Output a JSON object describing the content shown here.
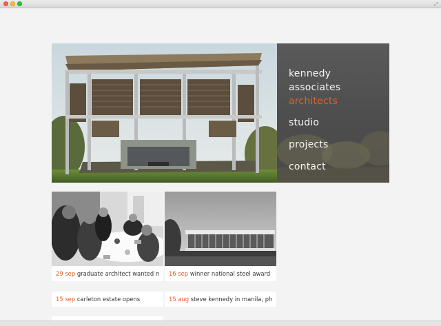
{
  "window": {
    "fullscreen_glyph": "⤢"
  },
  "brand": {
    "line1": "kennedy",
    "line2": "associates",
    "line3": "architects"
  },
  "nav": [
    {
      "label": "studio"
    },
    {
      "label": "projects"
    },
    {
      "label": "contact"
    }
  ],
  "news": [
    {
      "date": "29 sep",
      "text": "graduate architect wanted now"
    },
    {
      "date": "16 sep",
      "text": "winner national steel award"
    },
    {
      "date": "15 sep",
      "text": "carleton estate opens"
    },
    {
      "date": "15 aug",
      "text": "steve kennedy in manila, phili..."
    }
  ],
  "colors": {
    "accent": "#e2602a",
    "panel": "#555555",
    "background": "#f3f3f3"
  }
}
